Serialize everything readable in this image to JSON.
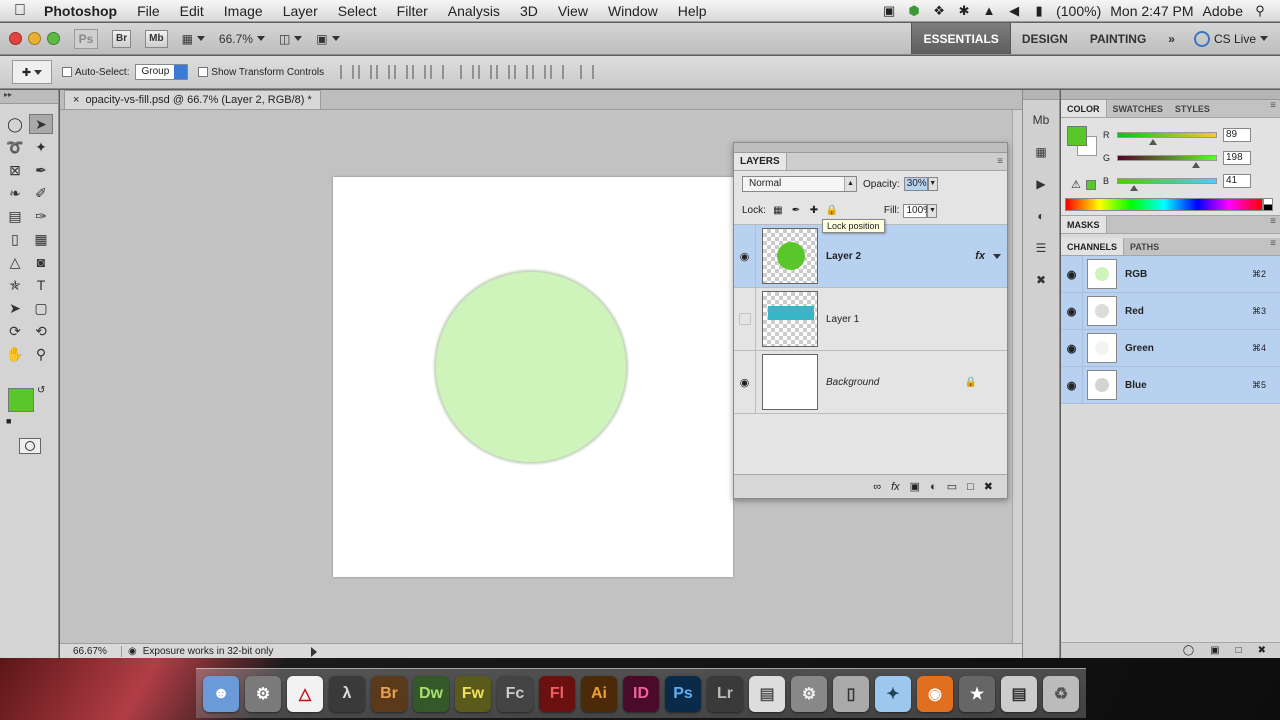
{
  "menubar": {
    "app_name": "Photoshop",
    "items": [
      "File",
      "Edit",
      "Image",
      "Layer",
      "Select",
      "Filter",
      "Analysis",
      "3D",
      "View",
      "Window",
      "Help"
    ],
    "battery": "(100%)",
    "clock": "Mon 2:47 PM",
    "user": "Adobe",
    "status_icons": [
      "camera-icon",
      "green-status-icon",
      "cursor-icon",
      "bluetooth-icon",
      "wifi-icon",
      "volume-icon",
      "battery-icon",
      "spotlight-icon"
    ]
  },
  "appbar": {
    "ps_logo": "Ps",
    "bridge_btn": "Br",
    "minibridge_btn": "Mb",
    "zoom": "66.7%",
    "workspaces": [
      "ESSENTIALS",
      "DESIGN",
      "PAINTING"
    ],
    "more": "»",
    "cs_live": "CS Live"
  },
  "optbar": {
    "auto_select_label": "Auto-Select:",
    "auto_select_value": "Group",
    "show_transform_label": "Show Transform Controls"
  },
  "document": {
    "tab_title": "opacity-vs-fill.psd @ 66.7% (Layer 2, RGB/8) *",
    "canvas_bg": "#ffffff",
    "circle_color": "#cff4bb"
  },
  "statusbar": {
    "zoom": "66.67%",
    "info": "Exposure works in 32-bit only"
  },
  "layers_panel": {
    "tab": "LAYERS",
    "blend_mode": "Normal",
    "opacity_label": "Opacity:",
    "opacity_value": "30%",
    "lock_label": "Lock:",
    "fill_label": "Fill:",
    "fill_value": "100%",
    "tooltip": "Lock position",
    "layers": [
      {
        "name": "Layer 2",
        "visible": true,
        "selected": true,
        "fx": "fx"
      },
      {
        "name": "Layer 1",
        "visible": false,
        "selected": false
      },
      {
        "name": "Background",
        "visible": true,
        "selected": false,
        "locked": true
      }
    ]
  },
  "color_panel": {
    "tabs": [
      "COLOR",
      "SWATCHES",
      "STYLES"
    ],
    "fg_color": "#59c629",
    "r_label": "R",
    "r": "89",
    "g_label": "G",
    "g": "198",
    "b_label": "B",
    "b": "41",
    "sliders": {
      "r": 0.35,
      "g": 0.78,
      "b": 0.16
    }
  },
  "masks_panel": {
    "tab": "MASKS"
  },
  "channels_panel": {
    "tabs": [
      "CHANNELS",
      "PATHS"
    ],
    "channels": [
      {
        "name": "RGB",
        "key": "⌘2"
      },
      {
        "name": "Red",
        "key": "⌘3"
      },
      {
        "name": "Green",
        "key": "⌘4"
      },
      {
        "name": "Blue",
        "key": "⌘5"
      }
    ]
  },
  "dock": {
    "apps": [
      "Br",
      "Dw",
      "Fw",
      "Fc",
      "Fl",
      "Ai",
      "ID",
      "Ps",
      "Lr"
    ]
  }
}
